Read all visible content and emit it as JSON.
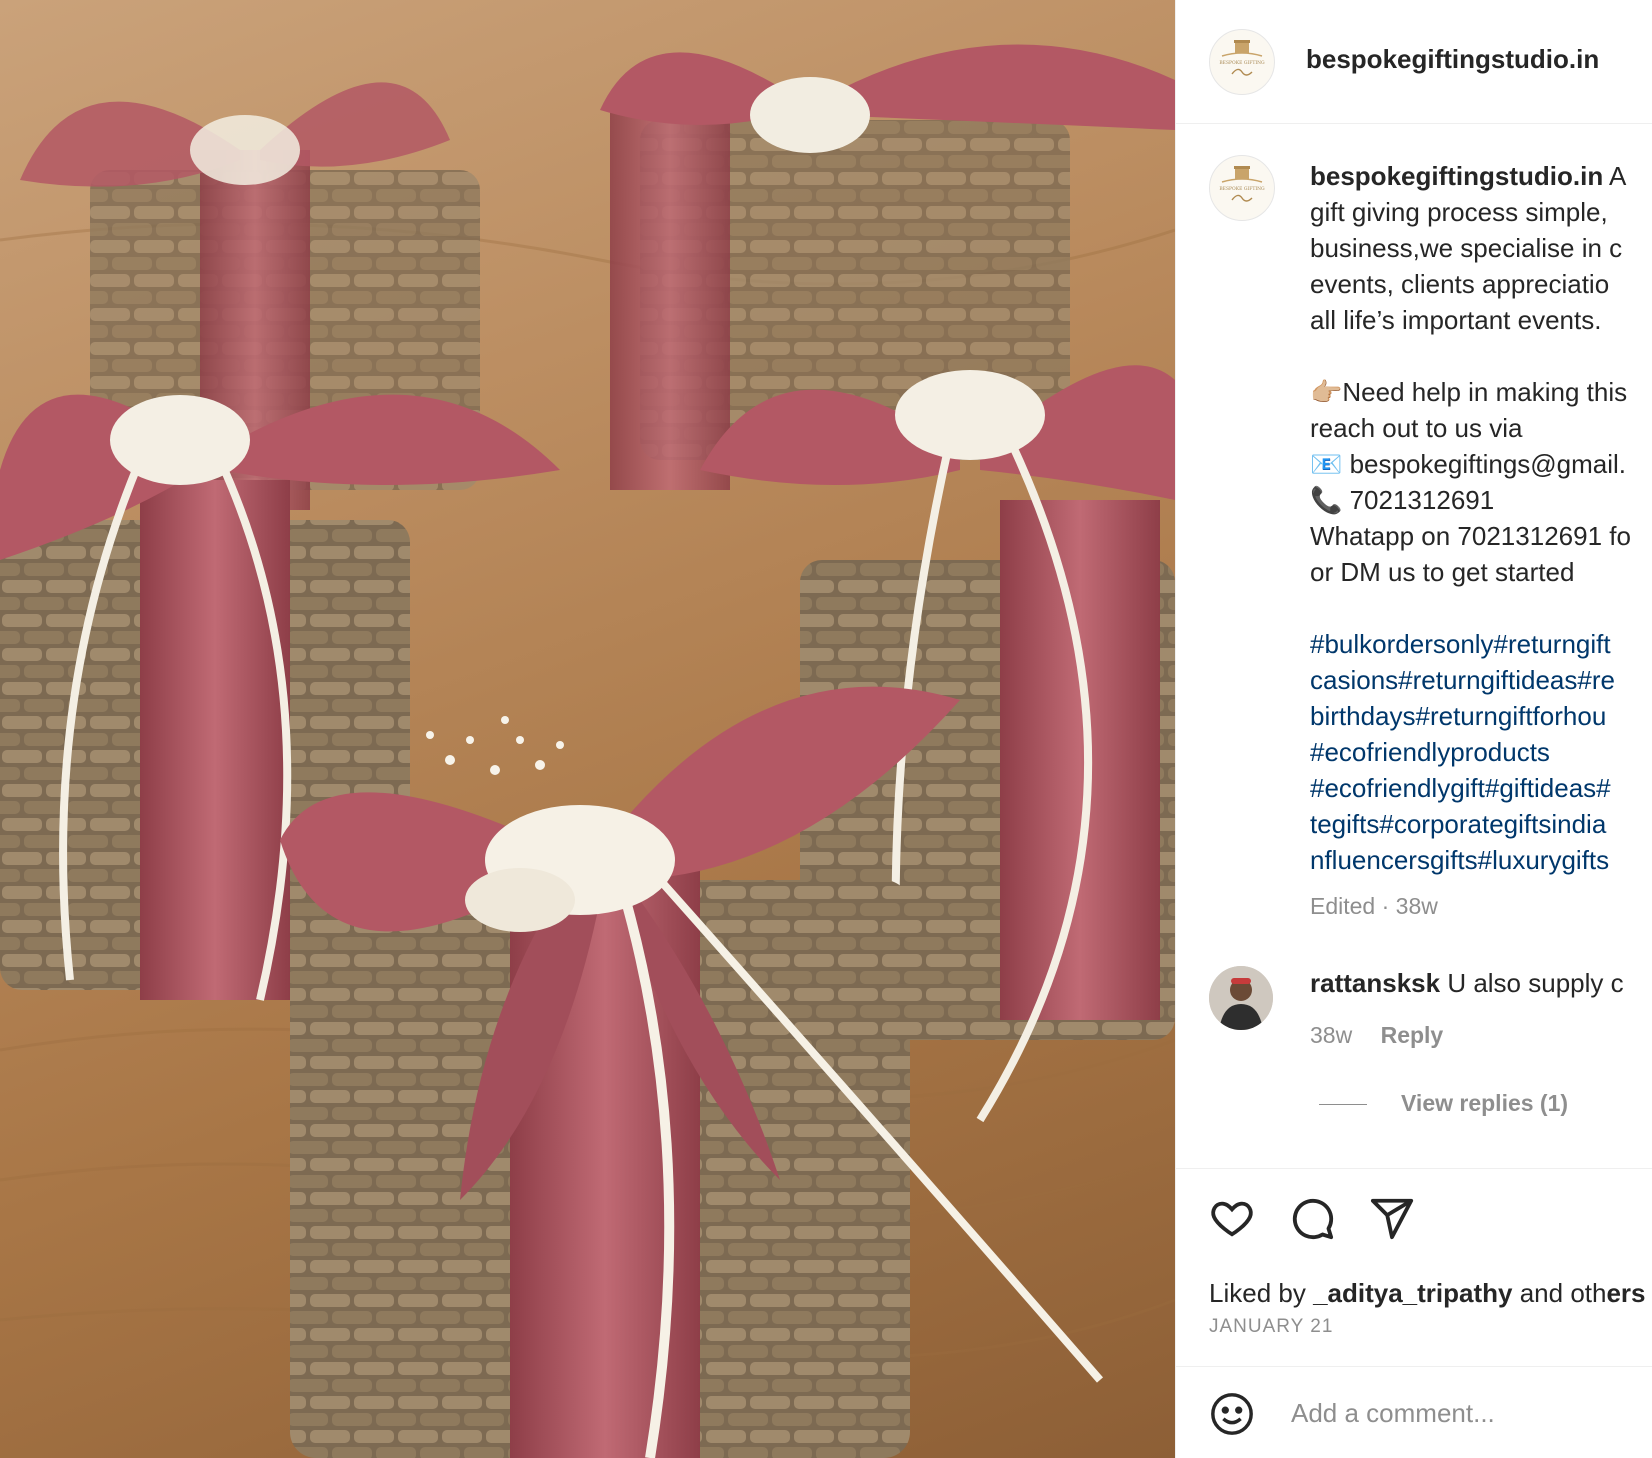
{
  "post": {
    "username": "bespokegiftingstudio.in",
    "avatar_logo_text": "BESPOKE GIFTING Studio",
    "caption_lines": [
      "A",
      "gift giving process simple,",
      "business,we specialise in c",
      "events, clients appreciatio",
      "all life’s important events.",
      "",
      "👉🏼Need help in making this",
      "reach out to us via",
      "📧 bespokegiftings@gmail.",
      "📞 7021312691",
      "Whatapp on 7021312691 fo",
      "or DM us to get started"
    ],
    "hashtag_lines": [
      "#bulkordersonly#returngift",
      "casions#returngiftideas#re",
      "birthdays#returngiftforhou",
      "#ecofriendlyproducts",
      "#ecofriendlygift#giftideas#",
      "tegifts#corporategiftsindia",
      "nfluencersgifts#luxurygifts"
    ],
    "edited_meta": "Edited · 38w"
  },
  "comment": {
    "username": "rattansksk",
    "text": "U also supply c",
    "time": "38w",
    "reply_label": "Reply",
    "view_replies": "View replies (1)"
  },
  "actions": {
    "like": "heart-icon",
    "comment": "comment-icon",
    "share": "share-icon"
  },
  "likes": {
    "prefix": "Liked by",
    "user": "_aditya_tripathy",
    "suffix": "and oth"
  },
  "date": "JANUARY 21",
  "add_comment": {
    "placeholder": "Add a comment..."
  },
  "colors": {
    "ribbon": "#b35864",
    "hashtag": "#00376b",
    "meta": "#8e8e8e"
  }
}
